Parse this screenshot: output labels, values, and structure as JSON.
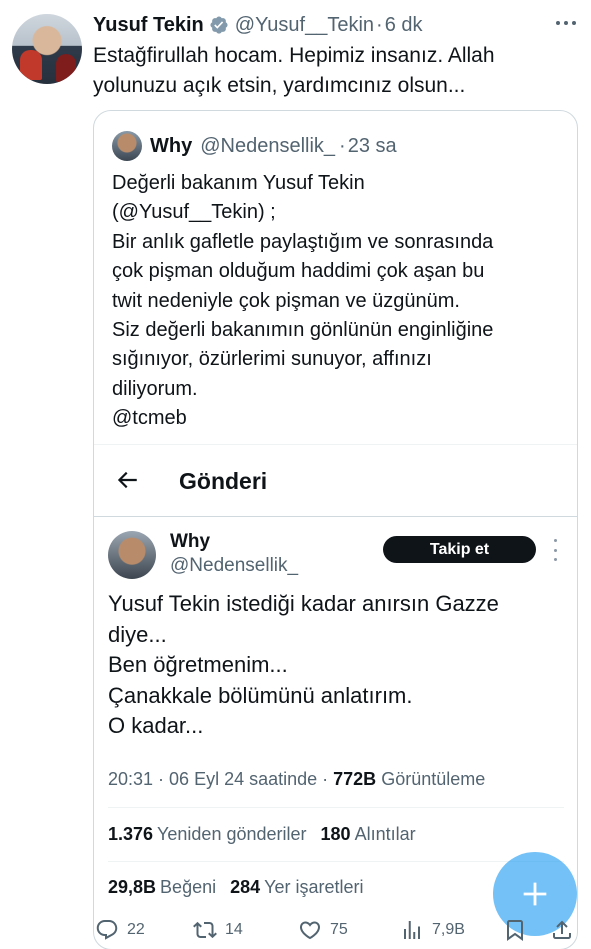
{
  "author": {
    "name": "Yusuf Tekin",
    "handle": "@Yusuf__Tekin",
    "separator": "·",
    "time": "6 dk",
    "text_lines": [
      "Estağfirullah hocam. Hepimiz insanız. Allah",
      "yolunuzu açık etsin, yardımcınız olsun..."
    ]
  },
  "quoted": {
    "name": "Why",
    "handle": "@Nedensellik_",
    "separator": "·",
    "time": "23 sa",
    "text_lines": [
      "Değerli bakanım Yusuf Tekin",
      "(@Yusuf__Tekin) ;",
      "Bir anlık gafletle paylaştığım ve sonrasında",
      "çok pişman olduğum haddimi çok aşan bu",
      "twit nedeniyle çok pişman ve üzgünüm.",
      "Siz değerli bakanımın gönlünün enginliğine",
      "sığınıyor,  özürlerimi sunuyor, affınızı",
      "diliyorum.",
      "@tcmeb"
    ]
  },
  "screenshot": {
    "header_title": "Gönderi",
    "name": "Why",
    "handle": "@Nedensellik_",
    "follow_label": "Takip et",
    "text_lines": [
      "Yusuf Tekin istediği kadar anırsın Gazze",
      "diye...",
      "Ben öğretmenim...",
      "Çanakkale bölümünü anlatırım.",
      "O kadar..."
    ],
    "meta_prefix": "20:31 · 06 Eyl 24 saatinde · ",
    "views_count": "772B",
    "views_label": "Görüntüleme",
    "retweets_count": "1.376",
    "retweets_label": "Yeniden gönderiler",
    "quotes_count": "180",
    "quotes_label": "Alıntılar",
    "likes_count": "29,8B",
    "likes_label": "Beğeni",
    "bookmarks_count": "284",
    "bookmarks_label": "Yer işaretleri"
  },
  "actions": {
    "replies": "22",
    "reposts": "14",
    "likes": "75",
    "views": "7,9B"
  },
  "colors": {
    "verified": "#829aab",
    "link": "#1d9bf0",
    "secondary_text": "#536471",
    "fab": "#1d9bf0"
  },
  "icons": [
    "verified-badge-icon",
    "more-horizontal-icon",
    "back-arrow-icon",
    "more-vertical-icon",
    "reply-icon",
    "repost-icon",
    "like-icon",
    "views-icon",
    "bookmark-icon",
    "share-icon",
    "compose-plus-icon"
  ]
}
